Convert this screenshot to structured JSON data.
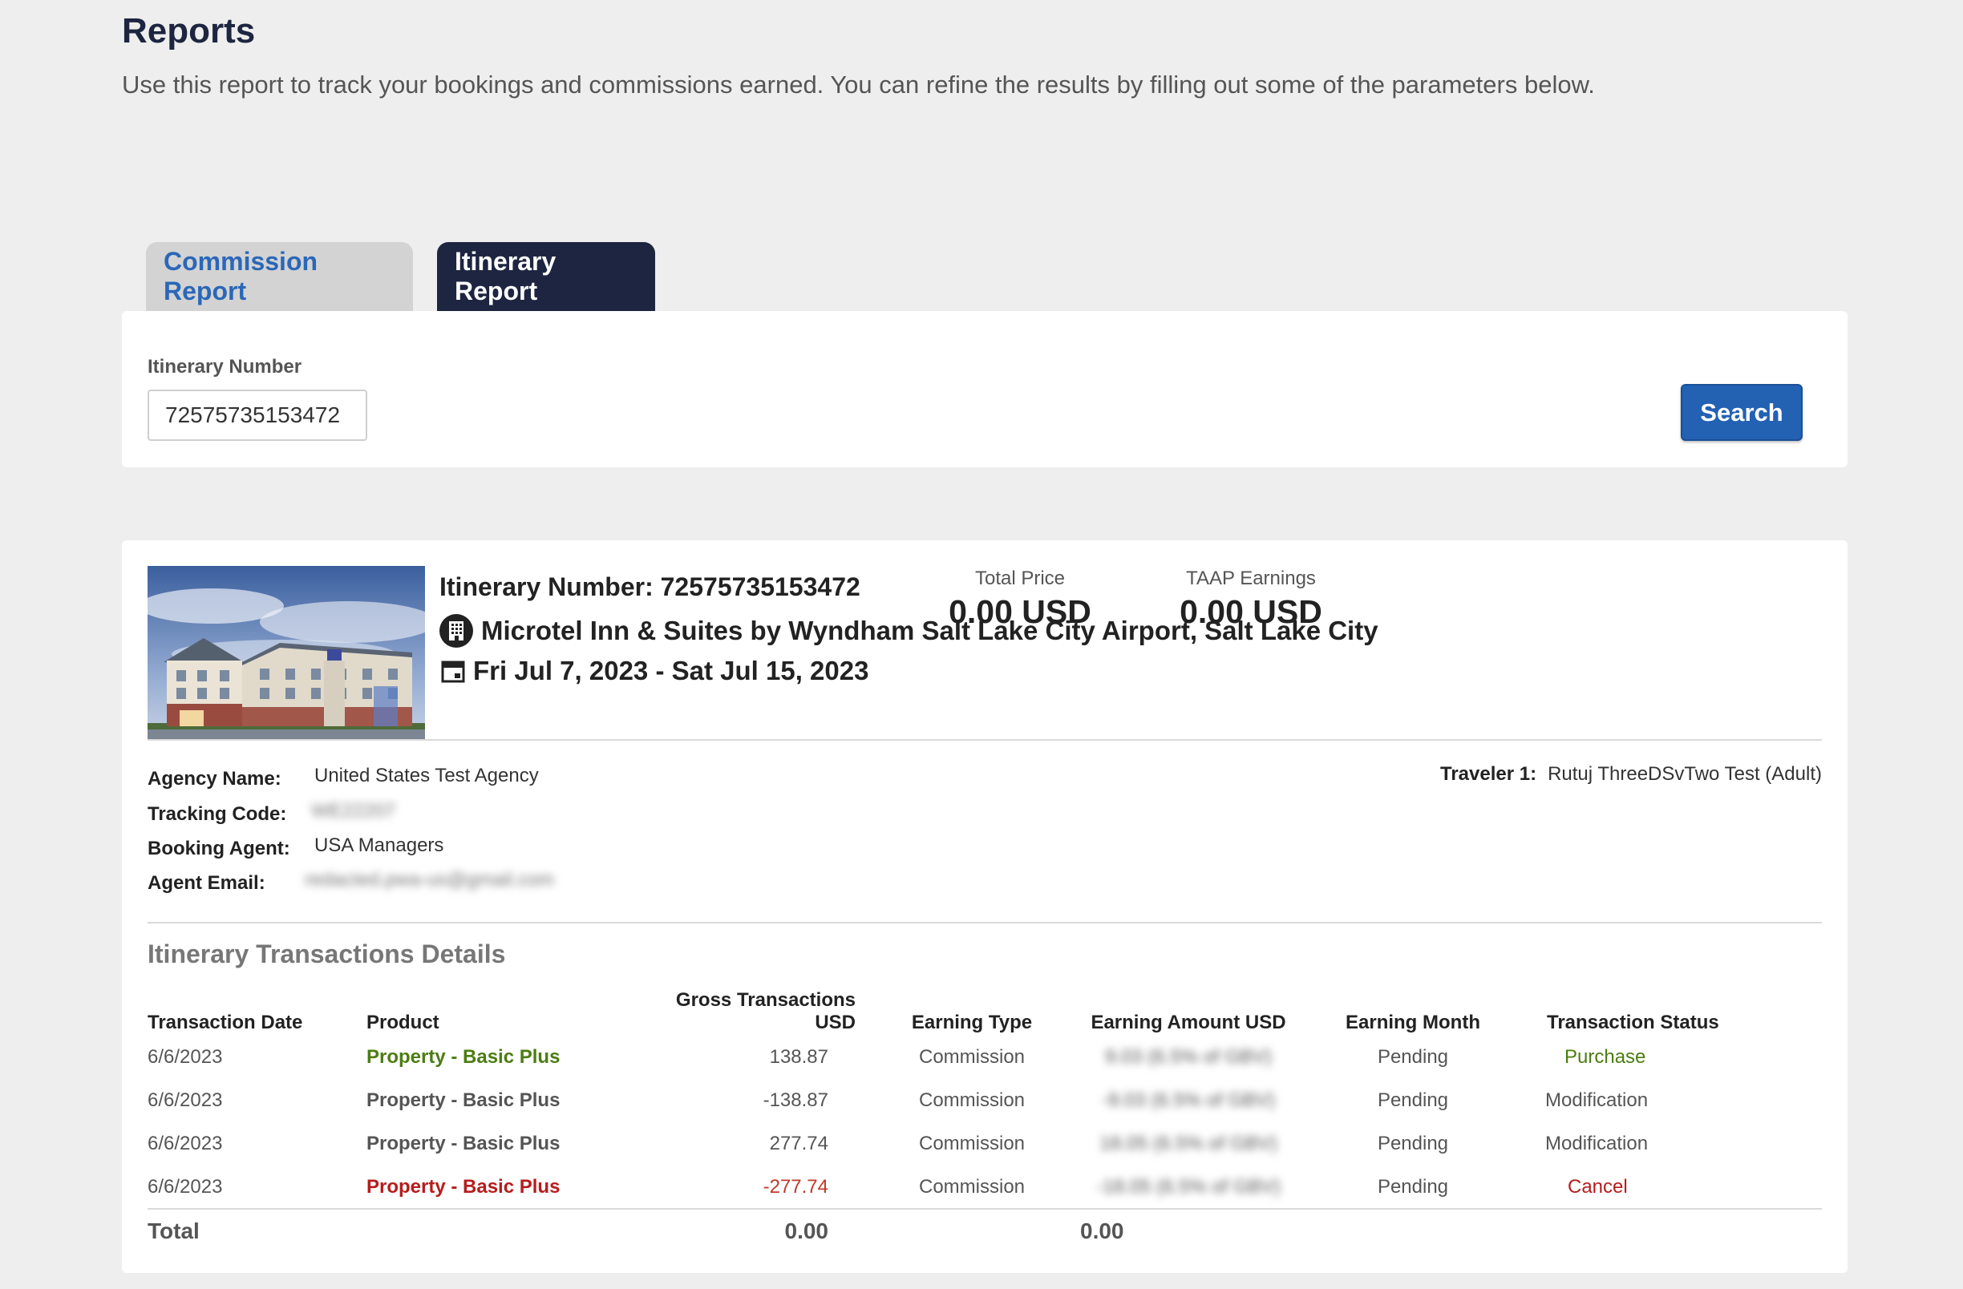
{
  "header": {
    "title": "Reports",
    "description": "Use this report to track your bookings and commissions earned. You can refine the results by filling out some of the parameters below."
  },
  "tabs": [
    {
      "label": "Commission Report",
      "active": false
    },
    {
      "label": "Itinerary Report",
      "active": true
    }
  ],
  "search": {
    "field_label": "Itinerary Number",
    "value": "72575735153472",
    "button_label": "Search"
  },
  "result": {
    "itinerary_heading": "Itinerary Number: 72575735153472",
    "hotel_name": "Microtel Inn & Suites by Wyndham Salt Lake City Airport, Salt Lake City",
    "dates": "Fri Jul 7, 2023 - Sat Jul 15, 2023",
    "total_price_label": "Total Price",
    "total_price_value": "0.00 USD",
    "taap_label": "TAAP Earnings",
    "taap_value": "0.00 USD",
    "agency_name_label": "Agency Name:",
    "agency_name_value": "United States Test Agency",
    "tracking_code_label": "Tracking Code:",
    "tracking_code_value": "WE22207",
    "booking_agent_label": "Booking Agent:",
    "booking_agent_value": "USA Managers",
    "agent_email_label": "Agent Email:",
    "agent_email_value": "redacted.pwa-us@gmail.com",
    "traveler_label": "Traveler 1:",
    "traveler_value": "Rutuj ThreeDSvTwo Test (Adult)"
  },
  "transactions": {
    "section_title": "Itinerary Transactions Details",
    "columns": [
      "Transaction Date",
      "Product",
      "Gross Transactions USD",
      "Earning Type",
      "Earning Amount USD",
      "Earning Month",
      "Transaction Status"
    ],
    "rows": [
      {
        "date": "6/6/2023",
        "product": "Property - Basic Plus",
        "gross": "138.87",
        "type": "Commission",
        "amount": "9.03 (6.5% of GBV)",
        "month": "Pending",
        "status": "Purchase"
      },
      {
        "date": "6/6/2023",
        "product": "Property - Basic Plus",
        "gross": "-138.87",
        "type": "Commission",
        "amount": "-9.03 (6.5% of GBV)",
        "month": "Pending",
        "status": "Modification"
      },
      {
        "date": "6/6/2023",
        "product": "Property - Basic Plus",
        "gross": "277.74",
        "type": "Commission",
        "amount": "18.05 (6.5% of GBV)",
        "month": "Pending",
        "status": "Modification"
      },
      {
        "date": "6/6/2023",
        "product": "Property - Basic Plus",
        "gross": "-277.74",
        "type": "Commission",
        "amount": "-18.05 (6.5% of GBV)",
        "month": "Pending",
        "status": "Cancel"
      }
    ],
    "total_label": "Total",
    "total_gross": "0.00",
    "total_amount": "0.00"
  },
  "colors": {
    "navy": "#1d2540",
    "accent_blue": "#2361b3",
    "purchase_green": "#4b7d12",
    "cancel_red": "#b71c1c"
  }
}
